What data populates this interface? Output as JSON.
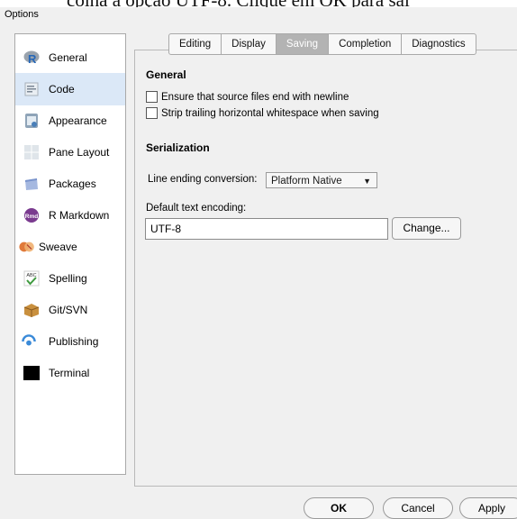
{
  "caption_fragment": "colha a opção UTF-8. Clique em OK para sal",
  "window": {
    "title": "Options"
  },
  "sidebar": {
    "items": [
      {
        "label": "General",
        "icon": "r-logo-icon"
      },
      {
        "label": "Code",
        "icon": "code-icon"
      },
      {
        "label": "Appearance",
        "icon": "appearance-icon"
      },
      {
        "label": "Pane Layout",
        "icon": "pane-layout-icon"
      },
      {
        "label": "Packages",
        "icon": "packages-icon"
      },
      {
        "label": "R Markdown",
        "icon": "rmarkdown-icon"
      },
      {
        "label": "Sweave",
        "icon": "sweave-icon"
      },
      {
        "label": "Spelling",
        "icon": "spelling-icon"
      },
      {
        "label": "Git/SVN",
        "icon": "git-icon"
      },
      {
        "label": "Publishing",
        "icon": "publishing-icon"
      },
      {
        "label": "Terminal",
        "icon": "terminal-icon"
      }
    ],
    "selected": "Code"
  },
  "tabs": [
    {
      "label": "Editing"
    },
    {
      "label": "Display"
    },
    {
      "label": "Saving",
      "active": true
    },
    {
      "label": "Completion"
    },
    {
      "label": "Diagnostics"
    }
  ],
  "general": {
    "title": "General",
    "ensure_newline": {
      "label": "Ensure that source files end with newline",
      "checked": false
    },
    "strip_whitespace": {
      "label": "Strip trailing horizontal whitespace when saving",
      "checked": false
    }
  },
  "serialization": {
    "title": "Serialization",
    "line_ending_label": "Line ending conversion:",
    "line_ending_value": "Platform Native",
    "encoding_label": "Default text encoding:",
    "encoding_value": "UTF-8",
    "change_label": "Change..."
  },
  "footer": {
    "ok": "OK",
    "cancel": "Cancel",
    "apply": "Apply"
  },
  "icon_glyphs": {
    "rmarkdown_badge": "Rmd",
    "spelling_badge": "ABC"
  },
  "colors": {
    "selected_bg": "#dbe8f7",
    "active_tab": "#b3b3b3",
    "dialog_bg": "#f0f0f0"
  }
}
